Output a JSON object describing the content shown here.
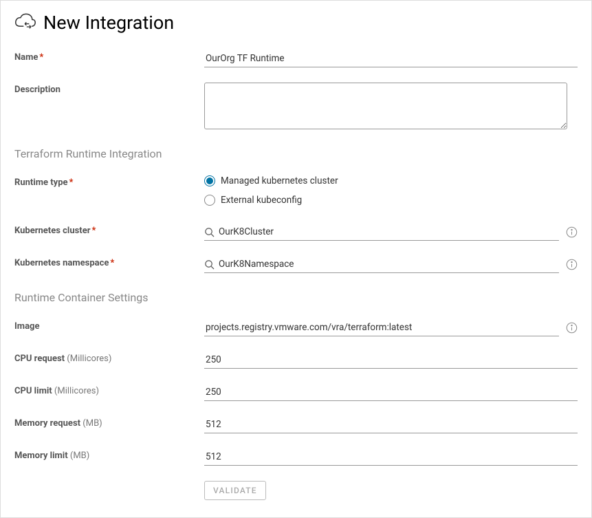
{
  "header": {
    "title": "New Integration"
  },
  "fields": {
    "name": {
      "label": "Name",
      "value": "OurOrg TF Runtime"
    },
    "description": {
      "label": "Description",
      "value": ""
    },
    "runtime_type": {
      "label": "Runtime type",
      "options": {
        "managed": "Managed kubernetes cluster",
        "external": "External kubeconfig"
      }
    },
    "k8s_cluster": {
      "label": "Kubernetes cluster",
      "value": "OurK8Cluster"
    },
    "k8s_namespace": {
      "label": "Kubernetes namespace",
      "value": "OurK8Namespace"
    },
    "image": {
      "label": "Image",
      "value": "projects.registry.vmware.com/vra/terraform:latest"
    },
    "cpu_request": {
      "label": "CPU request",
      "hint": "(Millicores)",
      "value": "250"
    },
    "cpu_limit": {
      "label": "CPU limit",
      "hint": "(Millicores)",
      "value": "250"
    },
    "mem_request": {
      "label": "Memory request",
      "hint": "(MB)",
      "value": "512"
    },
    "mem_limit": {
      "label": "Memory limit",
      "hint": "(MB)",
      "value": "512"
    }
  },
  "sections": {
    "runtime_integration": "Terraform Runtime Integration",
    "container_settings": "Runtime Container Settings"
  },
  "buttons": {
    "validate": "VALIDATE"
  }
}
